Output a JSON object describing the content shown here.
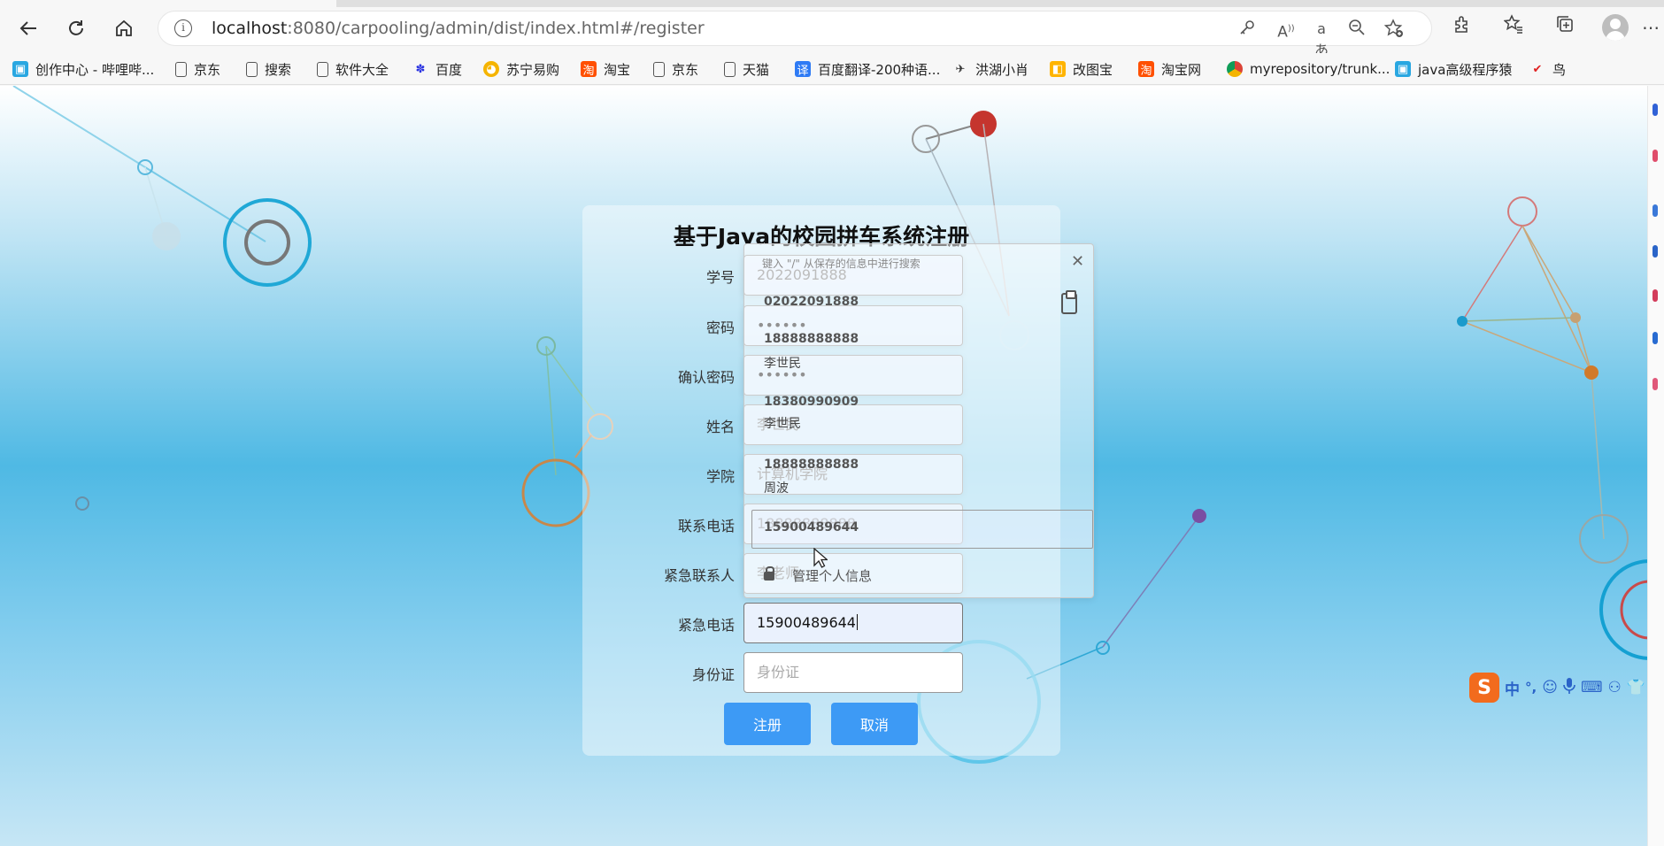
{
  "browser": {
    "url_host": "localhost",
    "url_rest": ":8080/carpooling/admin/dist/index.html#/register",
    "bookmarks": [
      {
        "label": "创作中心 - 哔哩哔...",
        "icon": "bilibili-icon"
      },
      {
        "label": "京东",
        "icon": "page-icon"
      },
      {
        "label": "搜索",
        "icon": "page-icon"
      },
      {
        "label": "软件大全",
        "icon": "page-icon"
      },
      {
        "label": "百度",
        "icon": "baidu-icon"
      },
      {
        "label": "苏宁易购",
        "icon": "suning-icon"
      },
      {
        "label": "淘宝",
        "icon": "taobao-icon"
      },
      {
        "label": "京东",
        "icon": "page-icon"
      },
      {
        "label": "天猫",
        "icon": "page-icon"
      },
      {
        "label": "百度翻译-200种语...",
        "icon": "translate-icon"
      },
      {
        "label": "洪湖小肖",
        "icon": "bird-icon"
      },
      {
        "label": "改图宝",
        "icon": "gaitubao-icon"
      },
      {
        "label": "淘宝网",
        "icon": "taobao-icon"
      },
      {
        "label": "myrepository/trunk...",
        "icon": "chrome-icon"
      },
      {
        "label": "java高级程序猿",
        "icon": "bilibili-icon"
      },
      {
        "label": "鸟",
        "icon": "bird-red-icon"
      }
    ]
  },
  "form": {
    "title": "基于Java的校园拼车系统注册",
    "fields": [
      {
        "label": "学号",
        "value": "2022091888"
      },
      {
        "label": "密码",
        "value": "••••••"
      },
      {
        "label": "确认密码",
        "value": "••••••"
      },
      {
        "label": "姓名",
        "value": "李世民"
      },
      {
        "label": "学院",
        "value": "计算机学院"
      },
      {
        "label": "联系电话",
        "value": "18888888888"
      },
      {
        "label": "紧急联系人",
        "value": "李老师"
      },
      {
        "label": "紧急电话",
        "value": "15900489644"
      },
      {
        "label": "身份证",
        "placeholder": "身份证"
      }
    ],
    "submit_label": "注册",
    "cancel_label": "取消"
  },
  "autofill": {
    "hint": "键入 \"/\" 从保存的信息中进行搜索",
    "items": [
      {
        "text": "02022091888",
        "bold": true
      },
      {
        "text": "18888888888",
        "bold": true
      },
      {
        "text": "李世民",
        "bold": false
      },
      {
        "text": "18380990909",
        "bold": true
      },
      {
        "text": "李世民",
        "bold": false
      },
      {
        "text": "18888888888",
        "bold": true
      },
      {
        "text": "周波",
        "bold": false
      },
      {
        "text": "15900489644",
        "bold": true
      }
    ],
    "manage_label": "管理个人信息"
  },
  "ime": {
    "logo": "S",
    "mode": "中",
    "punct": "°,"
  }
}
